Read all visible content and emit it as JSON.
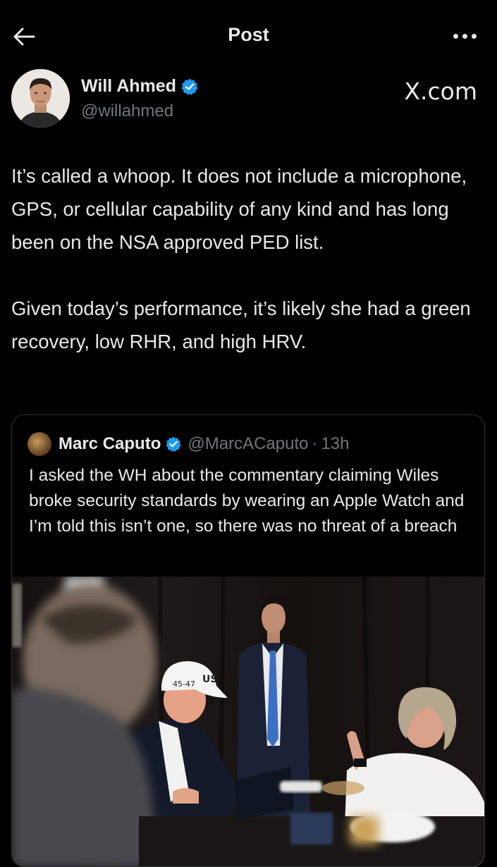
{
  "header": {
    "title": "Post",
    "back_icon": "arrow-left-icon",
    "more_icon": "more-horizontal-icon"
  },
  "post": {
    "author_name": "Will Ahmed",
    "author_handle": "@willahmed",
    "verified_color": "#1d9bf0",
    "source_label": "X.com",
    "paragraphs": [
      "It’s called a whoop. It does not include a microphone, GPS, or cellular capability of any kind and has long been on the NSA approved PED list.",
      "Given today’s performance, it’s likely she had a green recovery, low RHR, and high HRV."
    ]
  },
  "quote": {
    "author_name": "Marc Caputo",
    "author_handle": "@MarcACaputo",
    "separator": "·",
    "time": "13h",
    "text": "I asked the WH about the commentary claiming Wiles broke security standards by wearing an Apple Watch and I’m told this isn’t one, so there was no threat of a breach",
    "photo_hat_text": "45-47 US"
  },
  "colors": {
    "background": "#000000",
    "text_primary": "#e7e9ea",
    "text_secondary": "#71767b",
    "border": "#2f3336"
  }
}
